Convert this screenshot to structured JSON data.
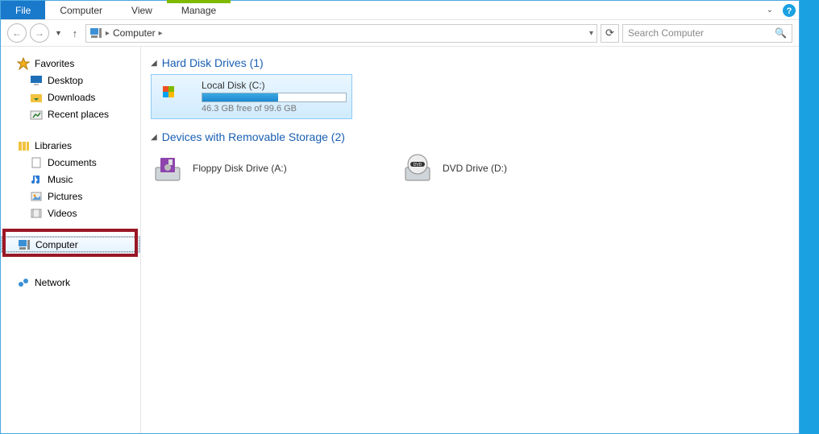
{
  "ribbon": {
    "file": "File",
    "tabs": [
      "Computer",
      "View",
      "Manage"
    ]
  },
  "nav": {
    "location": "Computer",
    "search_placeholder": "Search Computer"
  },
  "sidebar": {
    "favorites": {
      "label": "Favorites",
      "items": [
        {
          "label": "Desktop"
        },
        {
          "label": "Downloads"
        },
        {
          "label": "Recent places"
        }
      ]
    },
    "libraries": {
      "label": "Libraries",
      "items": [
        {
          "label": "Documents"
        },
        {
          "label": "Music"
        },
        {
          "label": "Pictures"
        },
        {
          "label": "Videos"
        }
      ]
    },
    "computer": {
      "label": "Computer"
    },
    "network": {
      "label": "Network"
    }
  },
  "sections": {
    "hdd": {
      "title": "Hard Disk Drives (1)",
      "drive": {
        "name": "Local Disk (C:)",
        "free": "46.3 GB free of 99.6 GB"
      }
    },
    "removable": {
      "title": "Devices with Removable Storage (2)",
      "items": [
        {
          "name": "Floppy Disk Drive (A:)"
        },
        {
          "name": "DVD Drive (D:)"
        }
      ]
    }
  }
}
